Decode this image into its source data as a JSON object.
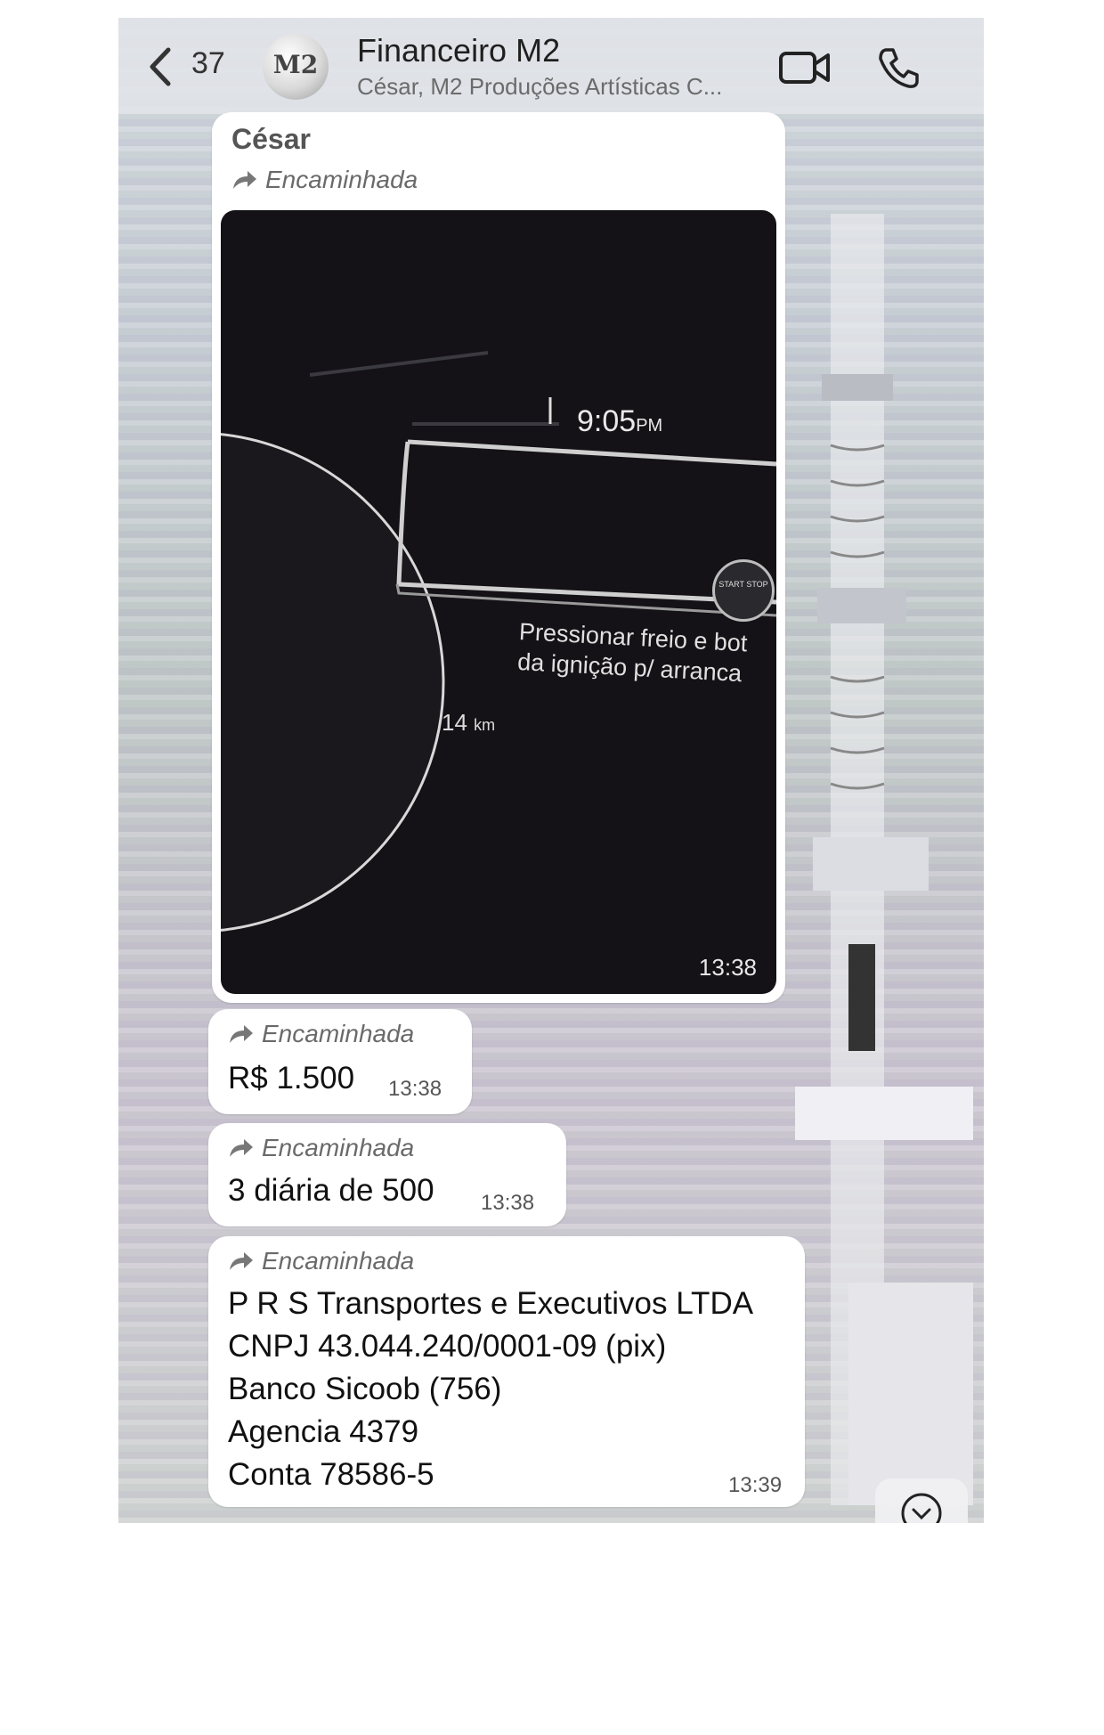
{
  "header": {
    "back_count": "37",
    "avatar_text": "M2",
    "title": "Financeiro M2",
    "subtitle": "César, M2 Produções Artísticas C..."
  },
  "photo_message": {
    "sender": "César",
    "forwarded_label": "Encaminhada",
    "dash_time": "9:05",
    "dash_ampm": "PM",
    "dash_line1": "Pressionar freio e bot",
    "dash_line2": "da ignição p/ arranca",
    "dash_km": "14",
    "dash_km_unit": "km",
    "start_stop": "START STOP",
    "timestamp": "13:38"
  },
  "messages": [
    {
      "forwarded_label": "Encaminhada",
      "text": "R$ 1.500",
      "timestamp": "13:38"
    },
    {
      "forwarded_label": "Encaminhada",
      "text": "3 diária de 500",
      "timestamp": "13:38"
    },
    {
      "forwarded_label": "Encaminhada",
      "lines": [
        "P R S Transportes e Executivos LTDA",
        "CNPJ 43.044.240/0001-09 (pix)",
        "Banco Sicoob (756)",
        "Agencia 4379",
        "Conta 78586-5"
      ],
      "timestamp": "13:39"
    }
  ],
  "icons": {
    "back": "chevron-left-icon",
    "video": "video-camera-icon",
    "phone": "phone-icon",
    "forward": "forward-arrow-icon",
    "scroll": "chevron-down-icon"
  }
}
